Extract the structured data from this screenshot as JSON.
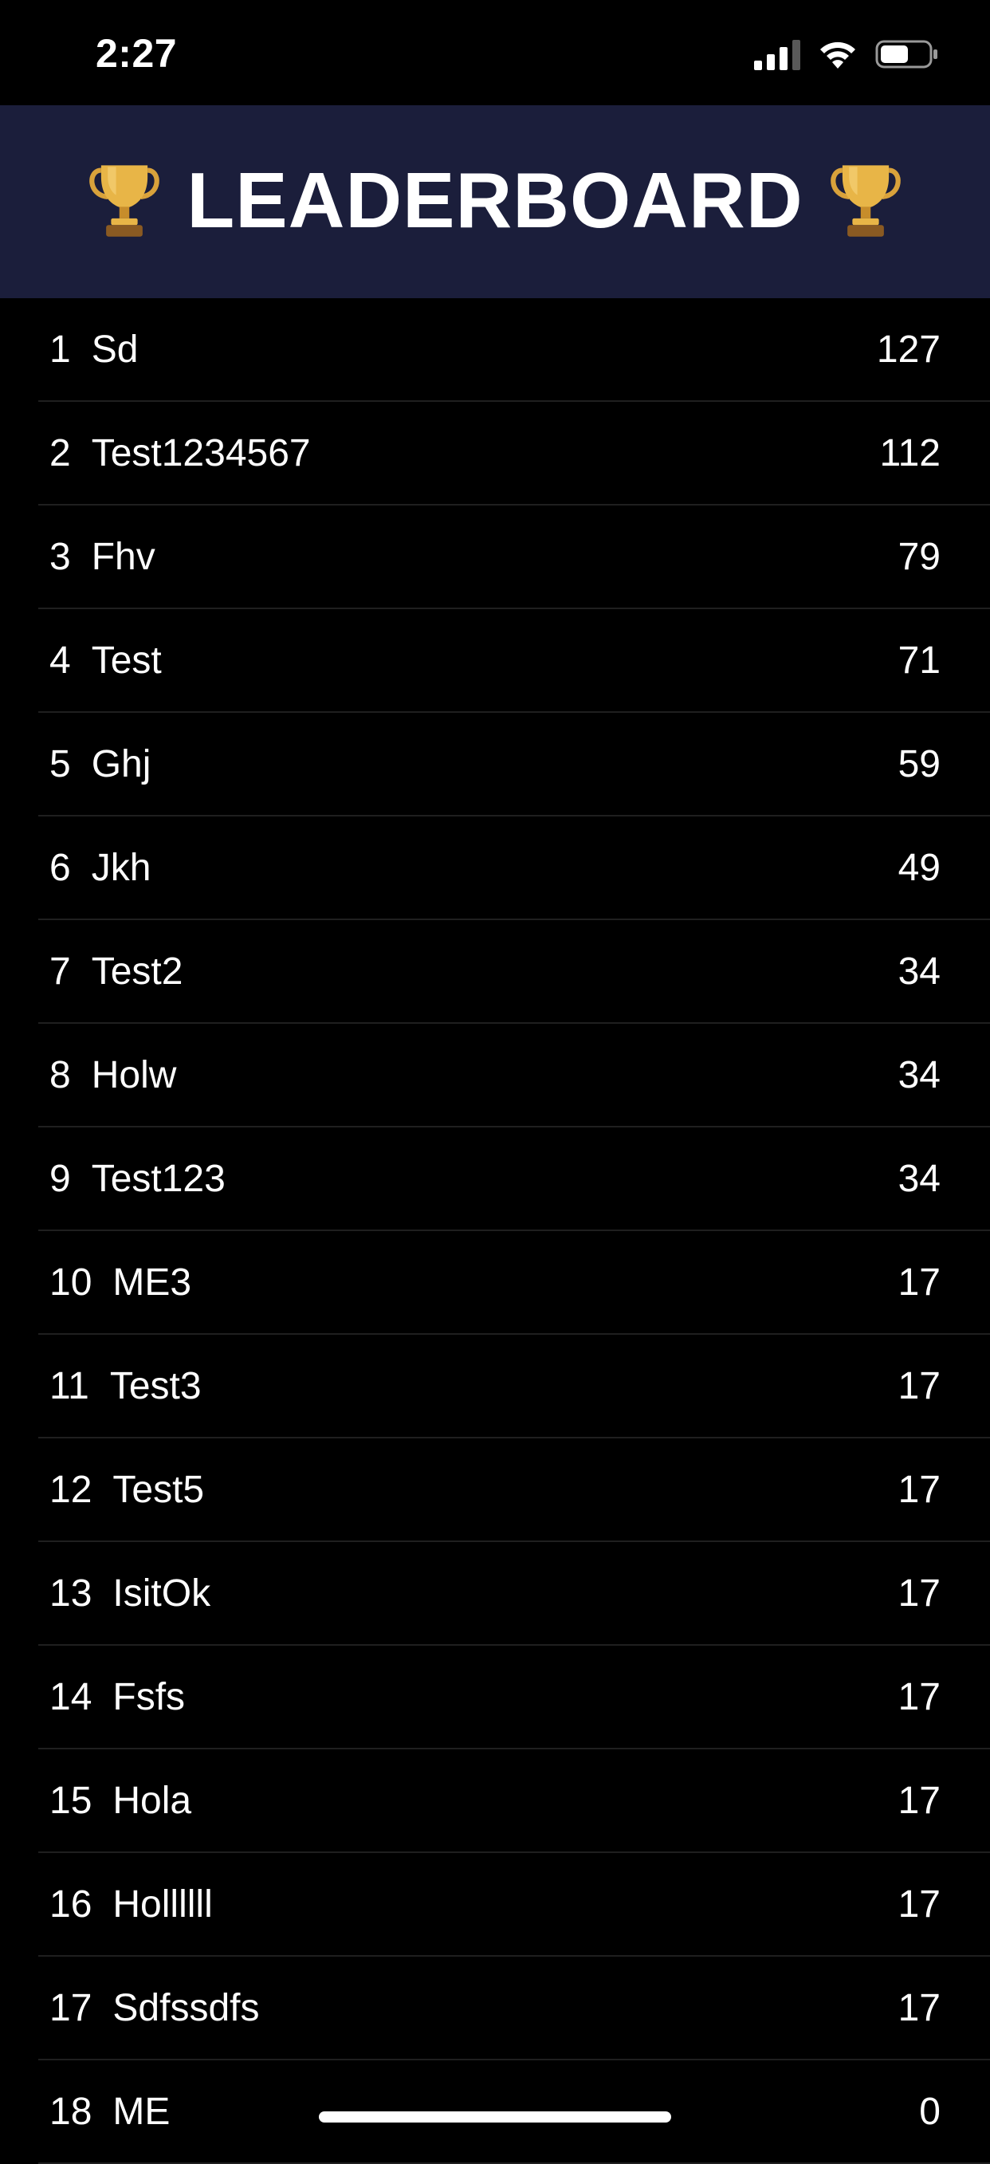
{
  "status_bar": {
    "time": "2:27"
  },
  "header": {
    "title": "LEADERBOARD",
    "icon": "trophy-icon"
  },
  "colors": {
    "header_bg": "#1b1e3b",
    "list_bg": "#000000",
    "divider": "#1f1f1f",
    "text": "#ffffff"
  },
  "leaderboard": [
    {
      "rank": "1",
      "name": "Sd",
      "score": "127"
    },
    {
      "rank": "2",
      "name": "Test1234567",
      "score": "112"
    },
    {
      "rank": "3",
      "name": "Fhv",
      "score": "79"
    },
    {
      "rank": "4",
      "name": "Test",
      "score": "71"
    },
    {
      "rank": "5",
      "name": "Ghj",
      "score": "59"
    },
    {
      "rank": "6",
      "name": "Jkh",
      "score": "49"
    },
    {
      "rank": "7",
      "name": "Test2",
      "score": "34"
    },
    {
      "rank": "8",
      "name": "Holw",
      "score": "34"
    },
    {
      "rank": "9",
      "name": "Test123",
      "score": "34"
    },
    {
      "rank": "10",
      "name": "ME3",
      "score": "17"
    },
    {
      "rank": "11",
      "name": "Test3",
      "score": "17"
    },
    {
      "rank": "12",
      "name": "Test5",
      "score": "17"
    },
    {
      "rank": "13",
      "name": "IsitOk",
      "score": "17"
    },
    {
      "rank": "14",
      "name": "Fsfs",
      "score": "17"
    },
    {
      "rank": "15",
      "name": "Hola",
      "score": "17"
    },
    {
      "rank": "16",
      "name": "Hollllll",
      "score": "17"
    },
    {
      "rank": "17",
      "name": "Sdfssdfs",
      "score": "17"
    },
    {
      "rank": "18",
      "name": "ME",
      "score": "0"
    }
  ]
}
